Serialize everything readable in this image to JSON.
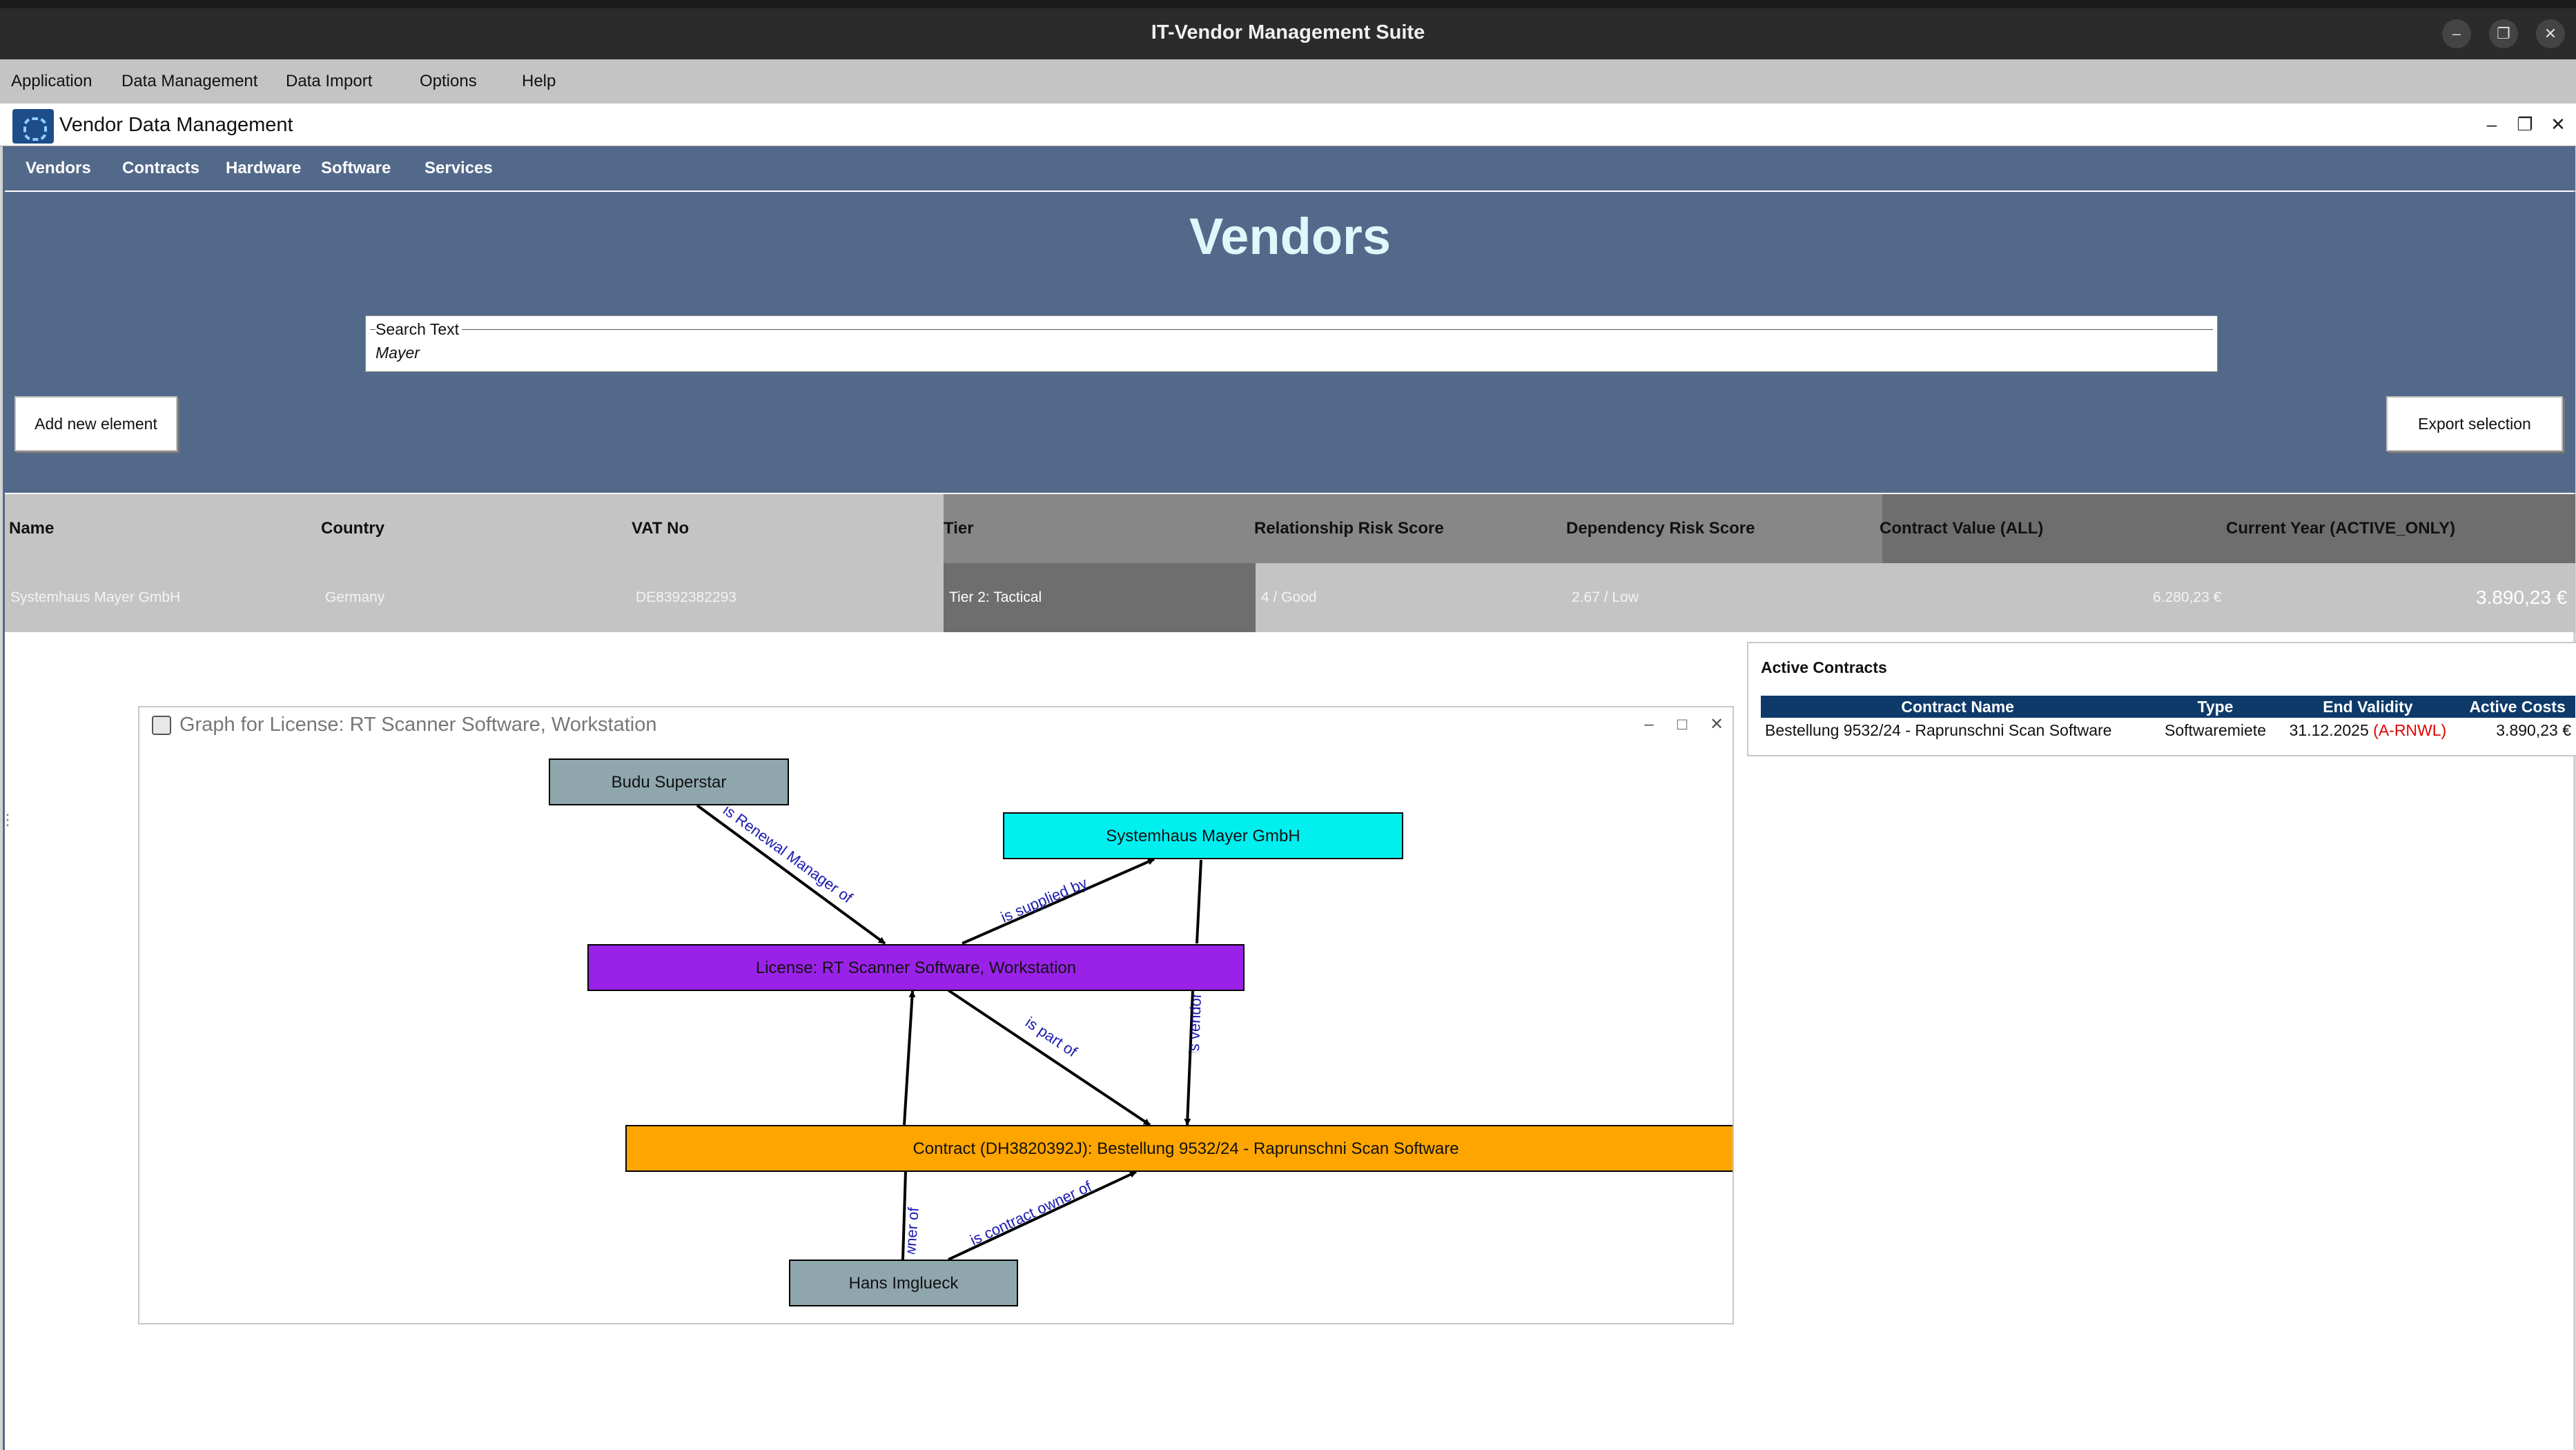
{
  "window": {
    "title": "IT-Vendor Management Suite"
  },
  "menu": {
    "items": [
      "Application",
      "Data Management",
      "Data Import",
      "Options",
      "Help"
    ]
  },
  "inner_window": {
    "title": "Vendor Data Management"
  },
  "nav": {
    "items": [
      "Vendors",
      "Contracts",
      "Hardware",
      "Software",
      "Services"
    ]
  },
  "page": {
    "heading": "Vendors"
  },
  "search": {
    "legend": "Search Text",
    "value": "Mayer"
  },
  "actions": {
    "add_label": "Add new element",
    "export_label": "Export selection"
  },
  "vendor_table": {
    "headers": [
      "Name",
      "Country",
      "VAT No",
      "Tier",
      "Relationship Risk Score",
      "Dependency Risk Score",
      "Contract Value (ALL)",
      "Current Year (ACTIVE_ONLY)"
    ],
    "row": {
      "name": "Systemhaus Mayer GmbH",
      "country": "Germany",
      "vat": "DE8392382293",
      "tier": "Tier 2: Tactical",
      "relationship_risk": "4 / Good",
      "dependency_risk": "2.67 / Low",
      "contract_value": "6.280,23 €",
      "current_year": "3.890,23 €"
    }
  },
  "active_contracts": {
    "title": "Active Contracts",
    "headers": [
      "Contract Name",
      "Type",
      "End Validity",
      "Active Costs"
    ],
    "rows": [
      {
        "name": "Bestellung 9532/24 - Raprunschni Scan Software",
        "type": "Softwaremiete",
        "end": "31.12.2025",
        "flag": "(A-RNWL)",
        "cost": "3.890,23 €"
      }
    ]
  },
  "graph": {
    "title": "Graph for License: RT Scanner Software, Workstation",
    "nodes": {
      "budu": "Budu Superstar",
      "mayer": "Systemhaus Mayer GmbH",
      "license": "License: RT Scanner Software, Workstation",
      "contract": "Contract (DH3820392J): Bestellung 9532/24 - Raprunschni Scan Software",
      "hans": "Hans Imglueck"
    },
    "edges": {
      "renewal": "is Renewal Manager of",
      "supplied": "is supplied by",
      "vendor": "is vendor",
      "partof": "is part of",
      "appowner": "is App Owner of",
      "contractowner": "is contract owner of"
    }
  },
  "colors": {
    "banner": "#53698a",
    "heading": "#dff6fb",
    "person_node": "#8fa6ad",
    "vendor_node": "#00f0f0",
    "license_node": "#9a22e8",
    "contract_node": "#ffa500",
    "edge_label": "#1a1ab0",
    "flag_red": "#e00000"
  }
}
